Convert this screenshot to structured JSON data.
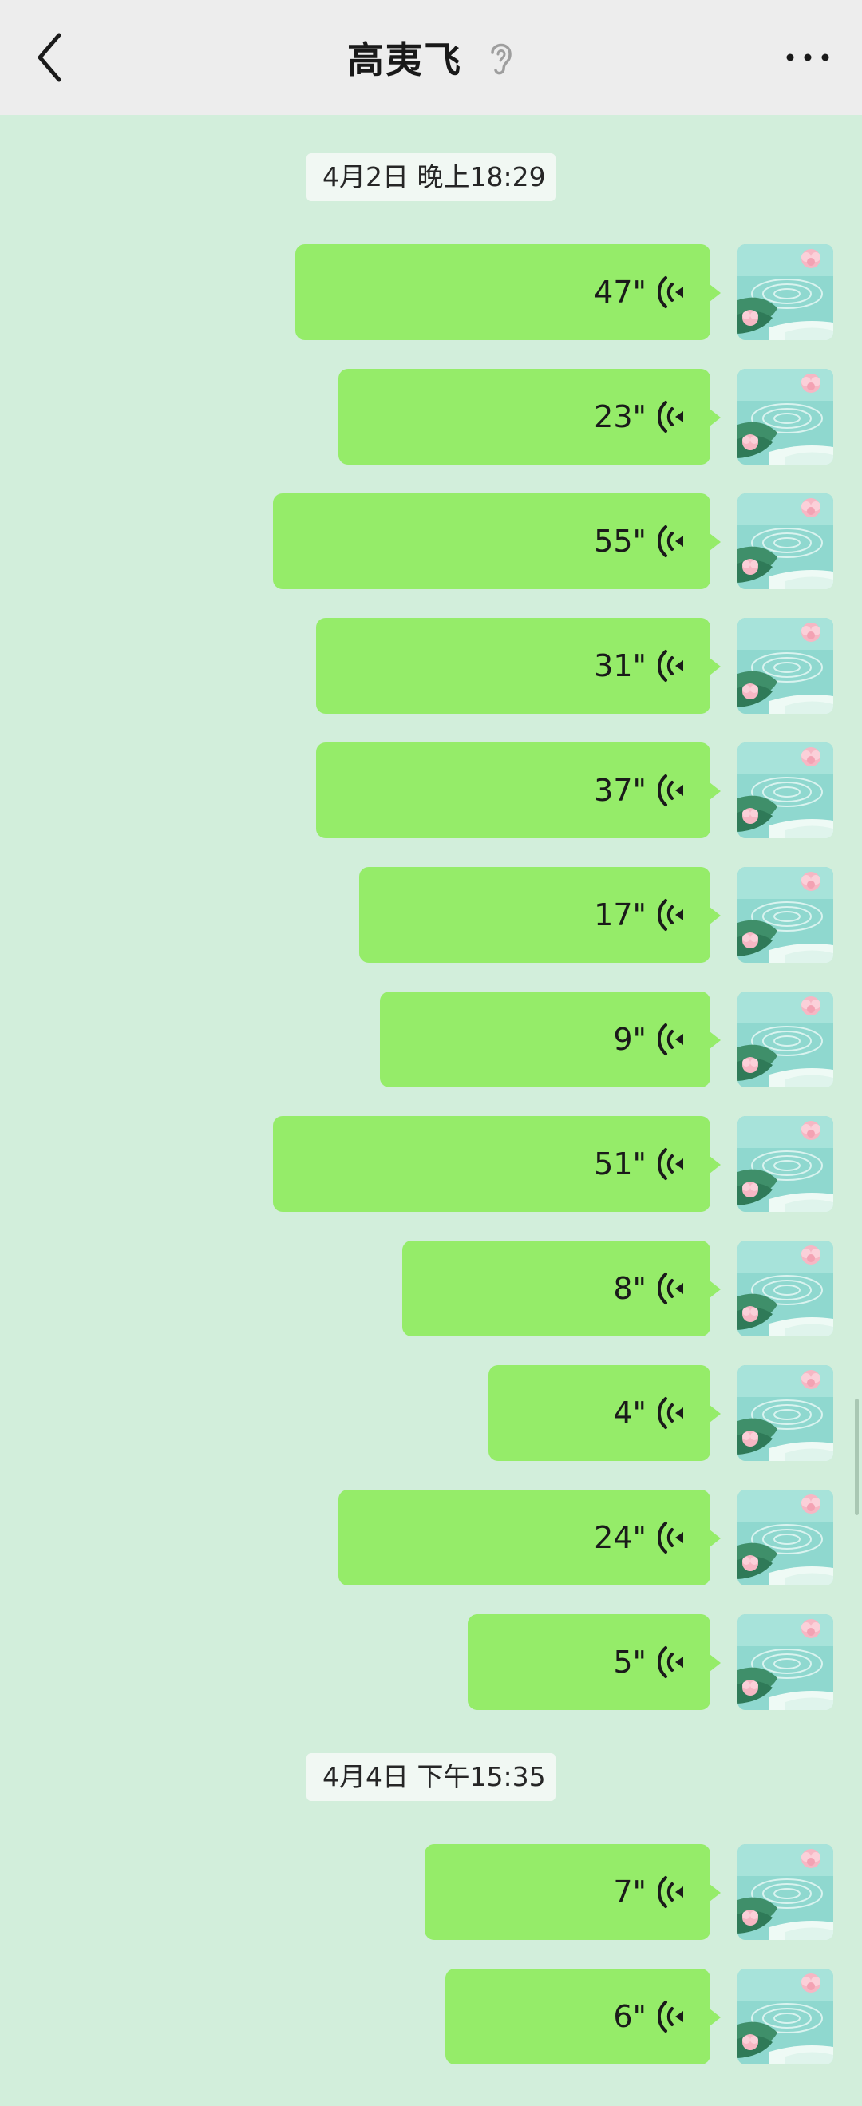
{
  "header": {
    "title": "高夷飞",
    "back_icon": "chevron-left-icon",
    "ear_icon": "ear-icon",
    "more_icon": "more-dots-icon"
  },
  "colors": {
    "background": "#d2eedb",
    "header": "#ededed",
    "bubble": "#95ec69"
  },
  "timestamps": [
    "4月2日 晚上18:29",
    "4月4日 下午15:35"
  ],
  "messages": [
    {
      "duration": "47\""
    },
    {
      "duration": "23\""
    },
    {
      "duration": "55\""
    },
    {
      "duration": "31\""
    },
    {
      "duration": "37\""
    },
    {
      "duration": "17\""
    },
    {
      "duration": "9\""
    },
    {
      "duration": "51\""
    },
    {
      "duration": "8\""
    },
    {
      "duration": "4\""
    },
    {
      "duration": "24\""
    },
    {
      "duration": "5\""
    },
    {
      "duration": "7\""
    },
    {
      "duration": "6\""
    }
  ]
}
